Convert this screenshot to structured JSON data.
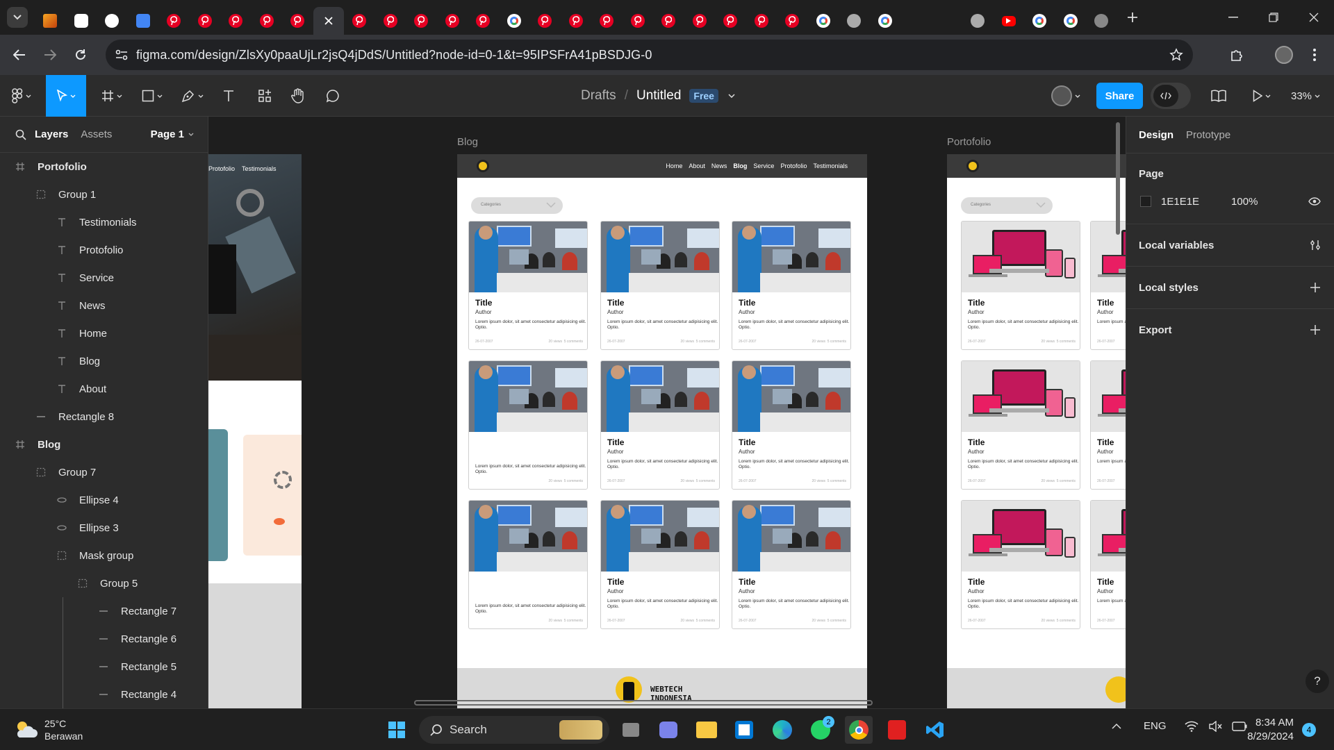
{
  "browser": {
    "tabs": [
      "vivaldi",
      "chatgpt",
      "github",
      "translate",
      "pinterest",
      "pinterest",
      "pinterest",
      "pinterest",
      "pinterest",
      "figma-active",
      "pinterest",
      "pinterest",
      "pinterest",
      "pinterest",
      "pinterest",
      "google",
      "pinterest",
      "pinterest",
      "pinterest",
      "pinterest",
      "pinterest",
      "pinterest",
      "pinterest",
      "pinterest",
      "pinterest",
      "google",
      "chrome",
      "google",
      "w",
      "w",
      "chrome",
      "youtube",
      "google",
      "google",
      "world"
    ],
    "url": "figma.com/design/ZlsXy0paaUjLr2jsQ4jDdS/Untitled?node-id=0-1&t=95IPSFrA41pBSDJG-0"
  },
  "toolbar": {
    "drafts": "Drafts",
    "slash": "/",
    "file_title": "Untitled",
    "plan_badge": "Free",
    "share_label": "Share",
    "zoom": "33%"
  },
  "layers_panel": {
    "tab_layers": "Layers",
    "tab_assets": "Assets",
    "page": "Page 1",
    "items": [
      {
        "label": "Portofolio",
        "icon": "frame-icon"
      },
      {
        "label": "Group 1",
        "icon": "group-icon"
      },
      {
        "label": "Testimonials",
        "icon": "text-icon"
      },
      {
        "label": "Protofolio",
        "icon": "text-icon"
      },
      {
        "label": "Service",
        "icon": "text-icon"
      },
      {
        "label": "News",
        "icon": "text-icon"
      },
      {
        "label": "Home",
        "icon": "text-icon"
      },
      {
        "label": "Blog",
        "icon": "text-icon"
      },
      {
        "label": "About",
        "icon": "text-icon"
      },
      {
        "label": "Rectangle 8",
        "icon": "rectangle-icon"
      },
      {
        "label": "Blog",
        "icon": "frame-icon"
      },
      {
        "label": "Group 7",
        "icon": "group-icon"
      },
      {
        "label": "Ellipse 4",
        "icon": "ellipse-icon"
      },
      {
        "label": "Ellipse 3",
        "icon": "ellipse-icon"
      },
      {
        "label": "Mask group",
        "icon": "group-icon"
      },
      {
        "label": "Group 5",
        "icon": "group-icon"
      },
      {
        "label": "Rectangle 7",
        "icon": "rectangle-icon"
      },
      {
        "label": "Rectangle 6",
        "icon": "rectangle-icon"
      },
      {
        "label": "Rectangle 5",
        "icon": "rectangle-icon"
      },
      {
        "label": "Rectangle 4",
        "icon": "rectangle-icon"
      }
    ]
  },
  "canvas": {
    "left_frame_nav": [
      "Protofolio",
      "Testimonials"
    ],
    "blog_frame": {
      "label": "Blog",
      "nav": [
        "Home",
        "About",
        "News",
        "Blog",
        "Service",
        "Protofolio",
        "Testimonials"
      ],
      "categories": "Categories",
      "card_title": "Title",
      "card_author": "Author",
      "card_desc": "Lorem ipsum dolor, sit amet consectetur adipisicing elit. Optio.",
      "card_date": "26-07-2007",
      "card_views": "20 views",
      "card_comments": "5 comments",
      "footer_logo_line1": "WEBTECH",
      "footer_logo_line2": "INDONESIA"
    },
    "portfolio_frame": {
      "label": "Portofolio",
      "categories": "Categories",
      "card_title": "Title",
      "card_author": "Author",
      "card_desc": "Lorem ipsum dolor, sit amet consectetur adipisicing elit. Optio.",
      "card_desc_short": "Lorem ipsum adipisicing e",
      "card_date": "26-07-2007",
      "card_views": "20 views",
      "card_comments": "5 comments"
    }
  },
  "design_panel": {
    "tab_design": "Design",
    "tab_prototype": "Prototype",
    "page_section": "Page",
    "page_color": "1E1E1E",
    "page_opacity": "100%",
    "local_variables": "Local variables",
    "local_styles": "Local styles",
    "export": "Export",
    "help": "?"
  },
  "taskbar": {
    "temperature": "25°C",
    "weather": "Berawan",
    "search": "Search",
    "language": "ENG",
    "time": "8:34 AM",
    "date": "8/29/2024",
    "notifications": "4",
    "whatsapp_badge": "2"
  },
  "colors": {
    "accent": "#0d99ff",
    "pinterest": "#e60023",
    "page_bg": "#1E1E1E"
  }
}
